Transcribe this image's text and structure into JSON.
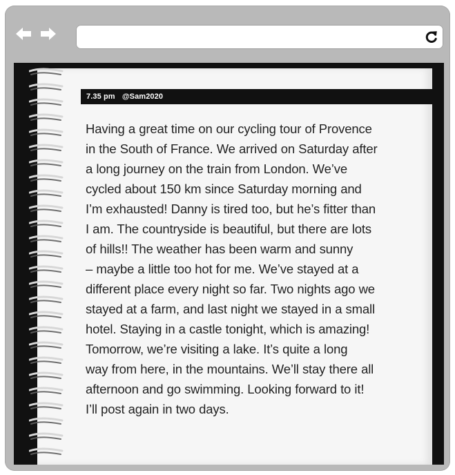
{
  "browser": {
    "address_value": "",
    "icons": {
      "back": "left-arrow-icon",
      "forward": "right-arrow-icon",
      "reload": "reload-icon"
    },
    "colors": {
      "frame": "#b9b9b9",
      "page_background": "#f6f6f6",
      "header_background": "#111111",
      "text": "#222222"
    }
  },
  "post": {
    "time": "7.35 pm",
    "user": "@Sam2020",
    "body_lines": [
      "Having a great time on our cycling tour of Provence",
      "in the South of France. We arrived on Saturday after",
      "a long journey on the train from London. We’ve",
      "cycled about 150 km since Saturday morning and",
      "I’m exhausted! Danny is tired too, but he’s fitter than",
      "I am. The countryside is beautiful, but there are lots",
      "of hills!! The weather has been warm and sunny",
      "– maybe a little too hot for me. We’ve stayed at a",
      "different place every night so far. Two nights ago we",
      "stayed at a farm, and last night we stayed in a small",
      "hotel. Staying in a castle tonight, which is amazing!",
      "Tomorrow, we’re visiting a lake. It’s quite a long",
      "way from here, in the mountains. We’ll stay there all",
      "afternoon and go swimming. Looking forward to it!",
      "I’ll post again in two days."
    ]
  }
}
